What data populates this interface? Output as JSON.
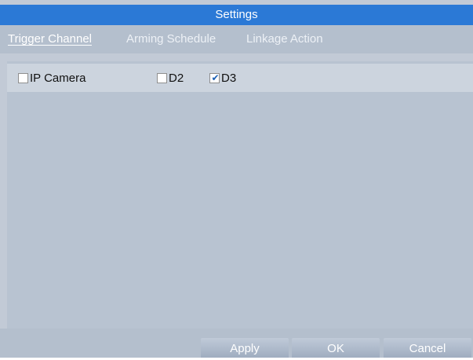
{
  "window": {
    "title": "Settings"
  },
  "tabs": [
    {
      "label": "Trigger Channel",
      "active": true
    },
    {
      "label": "Arming Schedule",
      "active": false
    },
    {
      "label": "Linkage Action",
      "active": false
    }
  ],
  "channels": [
    {
      "label": "IP Camera",
      "checked": false
    },
    {
      "label": "D2",
      "checked": false
    },
    {
      "label": "D3",
      "checked": true
    }
  ],
  "buttons": {
    "apply": "Apply",
    "ok": "OK",
    "cancel": "Cancel"
  },
  "colors": {
    "title_bar": "#2b79d6",
    "panel": "#b8c3d1",
    "check_mark": "#1a5fb4"
  }
}
